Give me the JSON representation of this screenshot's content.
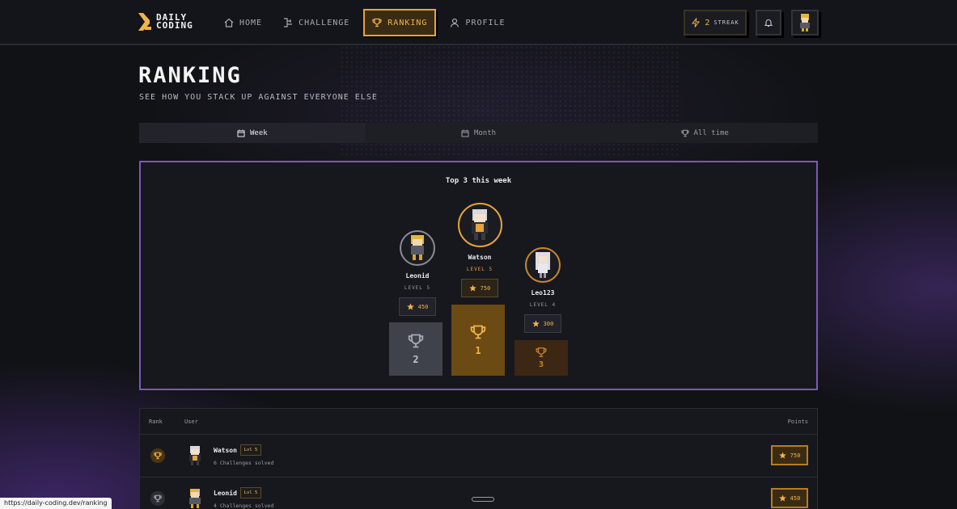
{
  "header": {
    "logo_line1": "DAILY",
    "logo_line2": "CODING",
    "nav": [
      {
        "label": "HOME",
        "icon": "home-icon"
      },
      {
        "label": "CHALLENGE",
        "icon": "challenge-icon"
      },
      {
        "label": "RANKING",
        "icon": "trophy-icon",
        "active": true
      },
      {
        "label": "PROFILE",
        "icon": "user-icon"
      }
    ],
    "streak_count": "2",
    "streak_label": "STREAK"
  },
  "page": {
    "title": "RANKING",
    "subtitle": "SEE HOW YOU STACK UP AGAINST EVERYONE ELSE"
  },
  "tabs": [
    {
      "label": "Week",
      "icon": "calendar-icon",
      "active": true
    },
    {
      "label": "Month",
      "icon": "calendar-icon"
    },
    {
      "label": "All time",
      "icon": "trophy-icon"
    }
  ],
  "podium": {
    "title": "Top 3 this week",
    "first": {
      "name": "Watson",
      "level": "LEVEL 5",
      "points": "750",
      "place": "1"
    },
    "second": {
      "name": "Leonid",
      "level": "LEVEL 5",
      "points": "450",
      "place": "2"
    },
    "third": {
      "name": "Leo123",
      "level": "LEVEL 4",
      "points": "300",
      "place": "3"
    }
  },
  "table": {
    "col_rank": "Rank",
    "col_user": "User",
    "col_points": "Points",
    "rows": [
      {
        "name": "Watson",
        "level": "Lvl 5",
        "solved": "6 Challenges solved",
        "points": "750"
      },
      {
        "name": "Leonid",
        "level": "Lvl 5",
        "solved": "4 Challenges solved",
        "points": "450"
      }
    ]
  },
  "status_url": "https://daily-coding.dev/ranking",
  "colors": {
    "accent": "#e7a33e",
    "panel_border": "#7b5ab8",
    "background": "#111216"
  }
}
